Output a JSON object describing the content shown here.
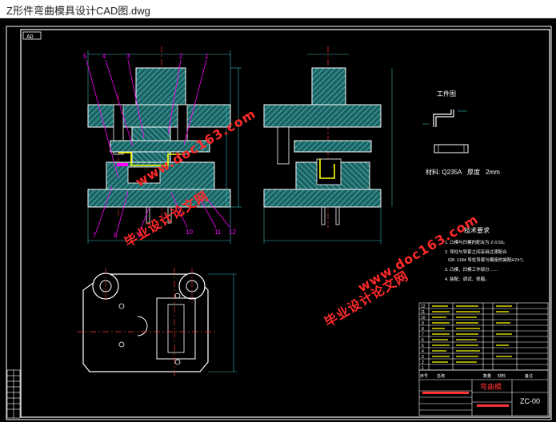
{
  "window": {
    "title": "Z形件弯曲模具设计CAD图.dwg"
  },
  "drawing": {
    "sheet_size": "A0",
    "part_label": "工件图",
    "material_note": "材料: Q235A",
    "thickness_label": "厚度",
    "thickness_value": "2mm",
    "tech_title": "技术要求",
    "tech_lines": [
      "1. 凸模与凹模的配合为 Z-0.5δ。",
      "2. 导柱与导套之间采用过渡配合",
      "GB. 1184 导柱导套与模座的装配H7/r7。",
      "3. 凸模、凹模工作部分……",
      "4. 装配、调试、修磨。"
    ],
    "callouts_top": [
      "5",
      "4",
      "3",
      "2",
      "1"
    ],
    "callouts_bottom": [
      "7",
      "8",
      "9",
      "10",
      "11",
      "12"
    ],
    "bom_rows": [
      "12",
      "11",
      "10",
      "9",
      "8",
      "7",
      "6",
      "5",
      "4",
      "3",
      "2",
      "1"
    ],
    "bom_footer": [
      "序号",
      "名称",
      "数量",
      "材料",
      "备注"
    ],
    "title_block": {
      "drawing_name": "弯曲模",
      "drawing_no": "ZC-00"
    },
    "colors": {
      "outline": "#ffffff",
      "hatch": "#4fc0c0",
      "centerline": "#ff3333",
      "leader": "#ff00ff",
      "dimension": "#35b9b9",
      "yellow": "#ffff00",
      "green": "#3cff3c"
    }
  },
  "watermarks": [
    "毕业设计论文网",
    "www.doc163.com",
    "毕业设计论文网",
    "www.doc163.com"
  ]
}
